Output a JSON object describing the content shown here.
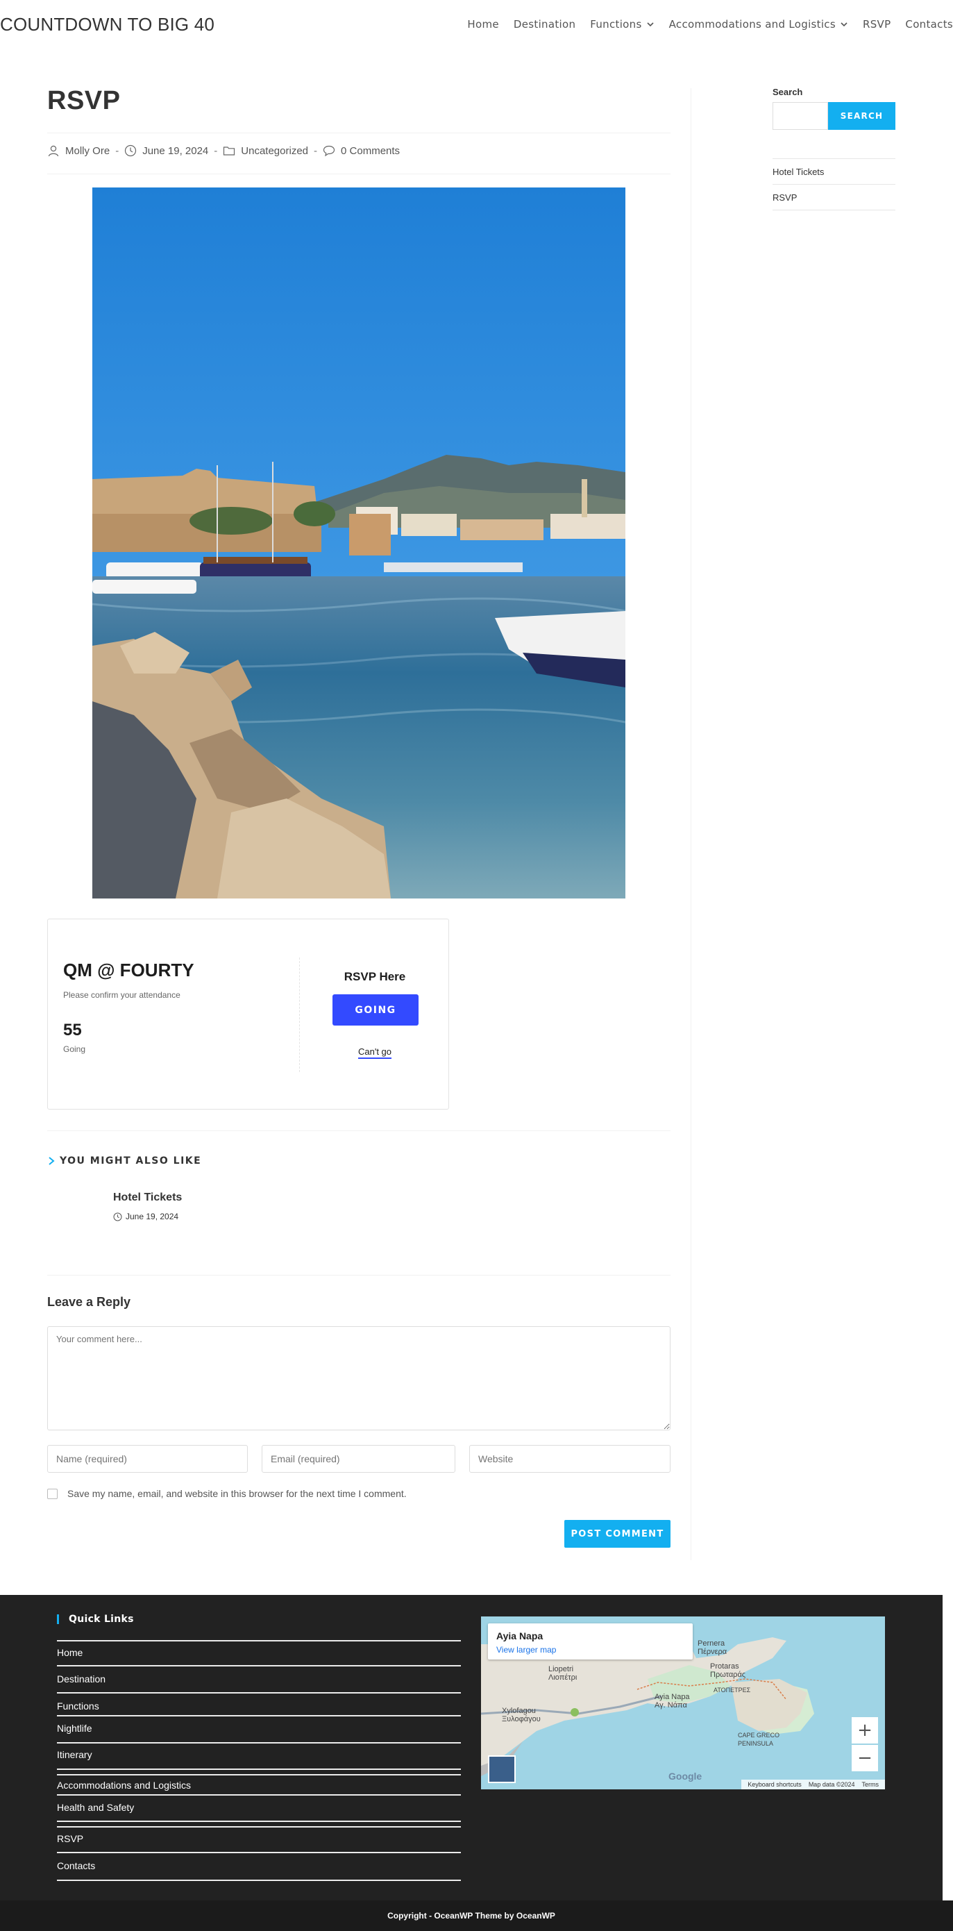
{
  "header": {
    "site_title": "COUNTDOWN TO BIG 40",
    "nav": [
      {
        "label": "Home"
      },
      {
        "label": "Destination"
      },
      {
        "label": "Functions"
      },
      {
        "label": "Accommodations and Logistics"
      },
      {
        "label": "RSVP"
      },
      {
        "label": "Contacts"
      }
    ]
  },
  "post": {
    "title": "RSVP",
    "author": "Molly Ore",
    "date": "June 19, 2024",
    "category": "Uncategorized",
    "comments": "0 Comments"
  },
  "rsvp": {
    "event_title": "QM @ FOURTY",
    "confirm_text": "Please confirm your attendance",
    "count": "55",
    "count_label": "Going",
    "rsvp_here": "RSVP Here",
    "going_button": "GOING",
    "cant_go": "Can't go"
  },
  "related": {
    "heading": "YOU MIGHT ALSO LIKE",
    "item_title": "Hotel Tickets",
    "item_date": "June 19, 2024"
  },
  "reply": {
    "title": "Leave a Reply",
    "comment_placeholder": "Your comment here...",
    "name_placeholder": "Name (required)",
    "email_placeholder": "Email (required)",
    "website_placeholder": "Website",
    "save_label": "Save my name, email, and website in this browser for the next time I comment.",
    "submit": "POST COMMENT"
  },
  "sidebar": {
    "search_label": "Search",
    "search_button": "SEARCH",
    "links": [
      "Hotel Tickets",
      "RSVP"
    ]
  },
  "footer": {
    "quick_links_heading": "Quick Links",
    "links": [
      "Home",
      "Destination",
      "Functions",
      "Nightlife",
      "Itinerary",
      "Accommodations and Logistics",
      "Health and Safety",
      "RSVP",
      "Contacts"
    ],
    "map": {
      "place": "Ayia Napa",
      "larger": "View larger map",
      "zoom_in": "+",
      "zoom_out": "−",
      "attribution": [
        "Keyboard shortcuts",
        "Map data ©2024",
        "Terms"
      ],
      "brand": "Google",
      "labels": [
        "Pernera\nΠέρνερα",
        "Liopetri\nΛιοπέτρι",
        "Protaras\nΠρωταράς",
        "ΑΤΟΠΕΤΡΕΣ",
        "Ayia Napa\nΑγ. Νάπα",
        "Xylofagou\nΞυλοφάγου",
        "CAPE GRECO\nPENINSULA"
      ]
    },
    "copyright": "Copyright - OceanWP Theme by OceanWP"
  },
  "colors": {
    "accent": "#13aff0",
    "rsvp_button": "#334aff",
    "footer_bg": "#222222"
  }
}
